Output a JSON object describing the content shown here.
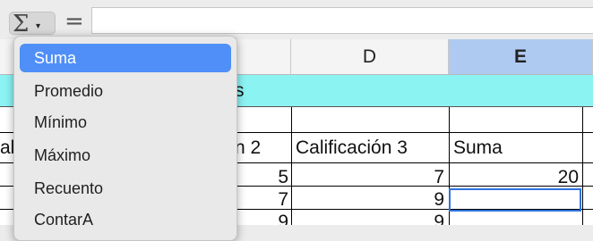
{
  "toolbar": {
    "sum_button_icon": "sigma-icon",
    "dropdown_icon": "caret-down-icon",
    "sum_symbol": "Σ",
    "caret_symbol": "▾",
    "equals_symbol": "=",
    "formula_value": ""
  },
  "columns": {
    "d": "D",
    "e": "E"
  },
  "band": {
    "partial_text": "s"
  },
  "headers": {
    "left_partial": "al",
    "calif2_partial": "n 2",
    "calif3": "Calificación 3",
    "suma": "Suma"
  },
  "rows": [
    {
      "c": "5",
      "d": "7",
      "e": "20"
    },
    {
      "c": "7",
      "d": "9",
      "e": ""
    },
    {
      "c": "9",
      "d": "9",
      "e": ""
    }
  ],
  "menu": {
    "items": [
      "Suma",
      "Promedio",
      "Mínimo",
      "Máximo",
      "Recuento",
      "ContarA"
    ],
    "highlighted_index": 0
  },
  "colors": {
    "band": "#8cf3f3",
    "selected_column_header": "#aecaf0",
    "menu_highlight": "#4f8ff7",
    "active_cell_border": "#2f72de"
  }
}
